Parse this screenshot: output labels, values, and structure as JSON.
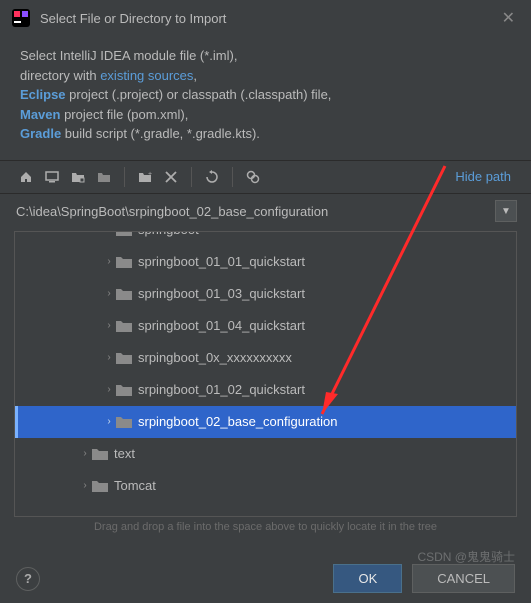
{
  "window": {
    "title": "Select File or Directory to Import"
  },
  "description": {
    "line1_a": "Select IntelliJ IDEA module file (*.iml),",
    "line2_a": "directory with ",
    "line2_b": "existing sources",
    "line2_c": ",",
    "line3_a": "Eclipse",
    "line3_b": " project (.project) or classpath (.classpath) file,",
    "line4_a": "Maven",
    "line4_b": " project file (pom.xml),",
    "line5_a": "Gradle",
    "line5_b": " build script (*.gradle, *.gradle.kts)."
  },
  "toolbar": {
    "hide_path": "Hide path"
  },
  "path": {
    "value": "C:\\idea\\SpringBoot\\srpingboot_02_base_configuration"
  },
  "tree": {
    "items": [
      {
        "label": "springboot",
        "indent": 84,
        "partial": true
      },
      {
        "label": "springboot_01_01_quickstart",
        "indent": 84
      },
      {
        "label": "springboot_01_03_quickstart",
        "indent": 84
      },
      {
        "label": "springboot_01_04_quickstart",
        "indent": 84
      },
      {
        "label": "srpingboot_0x_xxxxxxxxxx",
        "indent": 84
      },
      {
        "label": "srpingboot_01_02_quickstart",
        "indent": 84
      },
      {
        "label": "srpingboot_02_base_configuration",
        "indent": 84,
        "selected": true
      },
      {
        "label": "text",
        "indent": 60
      },
      {
        "label": "Tomcat",
        "indent": 60,
        "partial_bottom": true
      }
    ]
  },
  "hint": "Drag and drop a file into the space above to quickly locate it in the tree",
  "footer": {
    "ok": "OK",
    "cancel": "CANCEL"
  },
  "watermark": "CSDN @鬼鬼骑士"
}
